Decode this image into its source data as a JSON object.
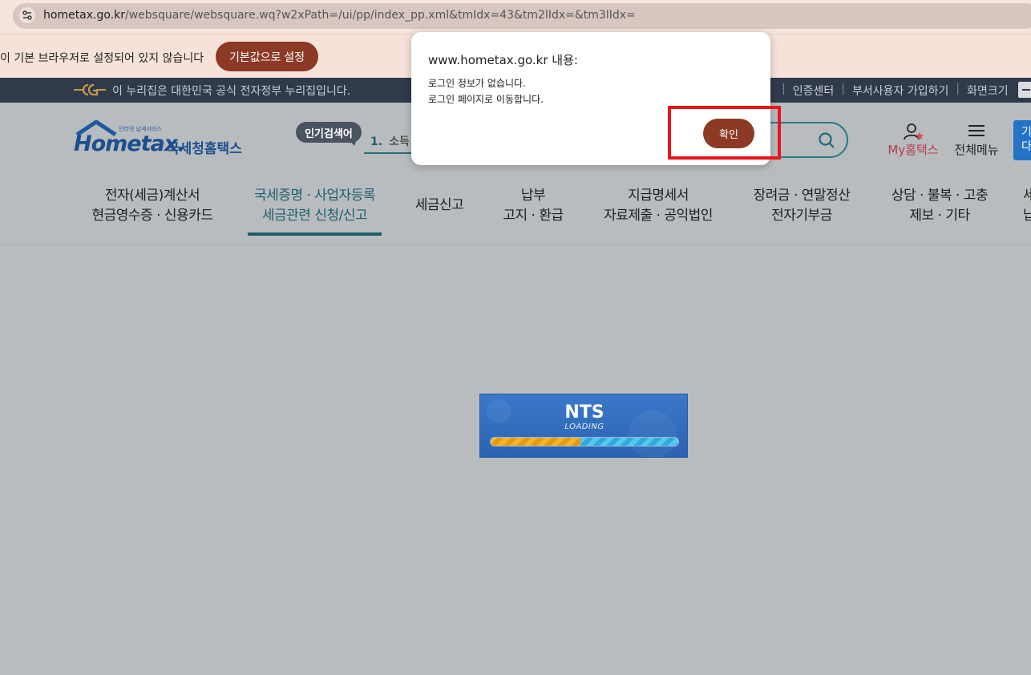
{
  "browser": {
    "address_host": "hometax.go.kr",
    "address_path": "/websquare/websquare.wq?w2xPath=/ui/pp/index_pp.xml&tmIdx=43&tm2lIdx=&tm3lIdx=",
    "infobar_text": "이 기본 브라우저로 설정되어 있지 않습니다",
    "infobar_button": "기본값으로 설정"
  },
  "gov_banner": {
    "text": "이 누리집은 대한민국 공식 전자정부 누리집입니다.",
    "links": [
      "인증센터",
      "부서사용자 가입하기",
      "화면크기"
    ]
  },
  "header": {
    "logo_brand": "Hometax.",
    "logo_small": "인터넷 납세서비스",
    "logo_kr": "국세청홈택스",
    "popular_badge": "인기검색어",
    "popular_rank": "1.",
    "popular_term": "소득",
    "my_label": "My홈택스",
    "menu_label": "전체메뉴",
    "right_button": [
      "기",
      "다"
    ]
  },
  "nav": [
    {
      "line1": "전자(세금)계산서",
      "line2": "현금영수증 · 신용카드"
    },
    {
      "line1": "국세증명 · 사업자등록",
      "line2": "세금관련 신청/신고",
      "active": true
    },
    {
      "line1": "세금신고",
      "line2": ""
    },
    {
      "line1": "납부",
      "line2": "고지 · 환급"
    },
    {
      "line1": "지급명세서",
      "line2": "자료제출 · 공익법인"
    },
    {
      "line1": "장려금 · 연말정산",
      "line2": "전자기부금"
    },
    {
      "line1": "상담 · 불복 · 고충",
      "line2": "제보 · 기타"
    },
    {
      "line1": "세",
      "line2": "납"
    }
  ],
  "dialog": {
    "title": "www.hometax.go.kr 내용:",
    "line1": "로그인 정보가 없습니다.",
    "line2": "로그인 페이지로 이동합니다.",
    "ok_label": "확인"
  },
  "loader": {
    "title": "NTS",
    "subtitle": "LOADING",
    "progress": 0.48
  },
  "colors": {
    "accent": "#8c3a26",
    "teal": "#1f5f6c",
    "highlight": "#e8151a"
  }
}
